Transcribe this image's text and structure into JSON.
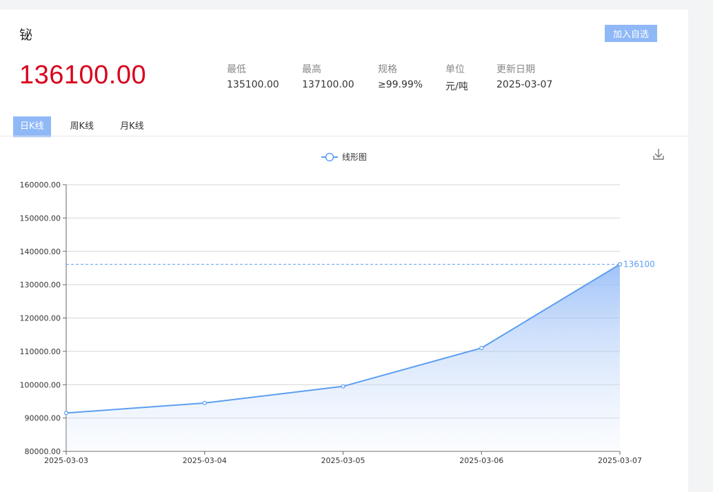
{
  "product": {
    "name": "铋",
    "price": "136100.00",
    "add_watch_label": "加入自选"
  },
  "stats": [
    {
      "label": "最低",
      "value": "135100.00"
    },
    {
      "label": "最高",
      "value": "137100.00"
    },
    {
      "label": "规格",
      "value": "≥99.99%"
    },
    {
      "label": "单位",
      "value": "元/吨"
    },
    {
      "label": "更新日期",
      "value": "2025-03-07"
    }
  ],
  "tabs": [
    {
      "label": "日K线",
      "active": true
    },
    {
      "label": "周K线",
      "active": false
    },
    {
      "label": "月K线",
      "active": false
    }
  ],
  "icons": {
    "download": "download-icon"
  },
  "colors": {
    "price": "#d9001b",
    "accent": "#8fb8f7",
    "line": "#5b9ef0"
  },
  "chart_data": {
    "type": "area",
    "legend": [
      "线形图"
    ],
    "legend_position": "top-center",
    "categories": [
      "2025-03-03",
      "2025-03-04",
      "2025-03-05",
      "2025-03-06",
      "2025-03-07"
    ],
    "series": [
      {
        "name": "线形图",
        "values": [
          91500,
          94500,
          99500,
          111000,
          136100
        ]
      }
    ],
    "ylim": [
      80000,
      160000
    ],
    "yticks": [
      "80000.00",
      "90000.00",
      "100000.00",
      "110000.00",
      "120000.00",
      "130000.00",
      "140000.00",
      "150000.00",
      "160000.00"
    ],
    "markline": {
      "value": 136100,
      "label": "136100"
    },
    "grid": true
  }
}
